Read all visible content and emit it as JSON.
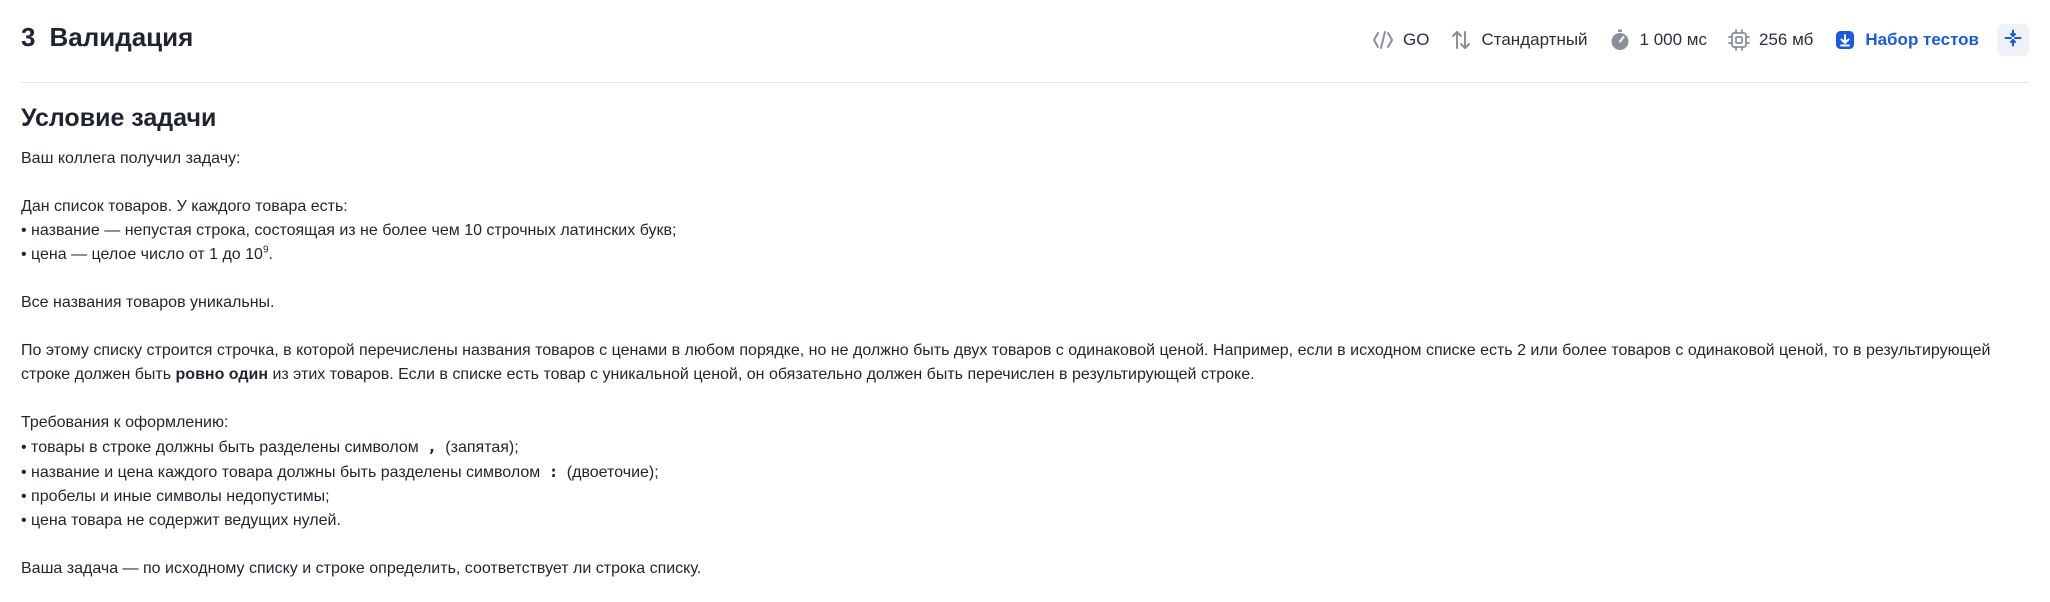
{
  "header": {
    "number": "3",
    "title": "Валидация",
    "language": "GO",
    "io_mode": "Стандартный",
    "time_limit": "1 000 мс",
    "memory_limit": "256 мб",
    "tests_link": "Набор тестов",
    "icons": [
      "code-icon",
      "arrows-swap-icon",
      "stopwatch-icon",
      "chip-icon",
      "download-icon",
      "expand-icon"
    ]
  },
  "statement": {
    "heading": "Условие задачи",
    "intro": "Ваш коллега получил задачу:",
    "given": "Дан список товаров. У каждого товара есть:",
    "item_name": "• название — непустая строка, состоящая из не более чем 10 строчных латинских букв;",
    "item_price_prefix": "• цена — целое число от 1 до 10",
    "item_price_exp": "9",
    "item_price_suffix": ".",
    "unique": "Все названия товаров уникальны.",
    "rule_part1": "По этому списку строится строчка, в которой перечислены названия товаров с ценами в любом порядке, но не должно быть двух товаров с одинаковой ценой. Например, если в исходном списке есть 2 или более товаров с одинаковой ценой, то в результирующей строке должен быть ",
    "rule_bold": "ровно один",
    "rule_part2": " из этих товаров. Если в списке есть товар с уникальной ценой, он обязательно должен быть перечислен в результирующей строке.",
    "format_heading": "Требования к оформлению:",
    "format_1_prefix": "• товары в строке должны быть разделены символом ",
    "format_1_code": ",",
    "format_1_suffix": " (запятая);",
    "format_2_prefix": "• название и цена каждого товара должны быть разделены символом ",
    "format_2_code": ":",
    "format_2_suffix": " (двоеточие);",
    "format_3": "• пробелы и иные символы недопустимы;",
    "format_4": "• цена товара не содержит ведущих нулей.",
    "task": "Ваша задача — по исходному списку и строке определить, соответствует ли строка списку."
  },
  "colors": {
    "accent": "#1a5ae0",
    "text": "#1f2430",
    "icon": "#8a8f99",
    "divider": "#e3e6ec"
  }
}
